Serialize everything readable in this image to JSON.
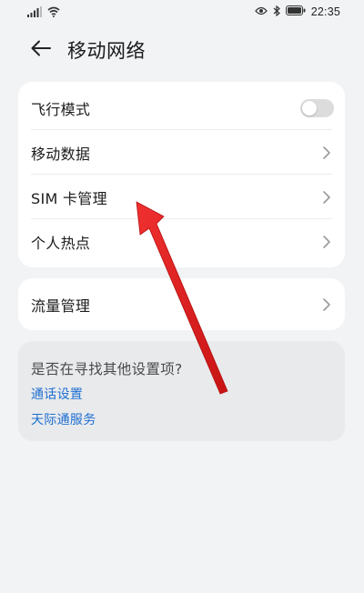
{
  "status_bar": {
    "time": "22:35",
    "icons": [
      "signal-icon",
      "wifi-icon",
      "eye-icon",
      "bluetooth-icon",
      "battery-icon"
    ]
  },
  "header": {
    "title": "移动网络",
    "back_icon": "back-arrow-icon"
  },
  "main_group": {
    "items": [
      {
        "label": "飞行模式",
        "control": "toggle",
        "toggle_on": false
      },
      {
        "label": "移动数据",
        "control": "chevron"
      },
      {
        "label": "SIM 卡管理",
        "control": "chevron"
      },
      {
        "label": "个人热点",
        "control": "chevron"
      }
    ]
  },
  "traffic_group": {
    "items": [
      {
        "label": "流量管理",
        "control": "chevron"
      }
    ]
  },
  "suggestions": {
    "title": "是否在寻找其他设置项?",
    "links": [
      "通话设置",
      "天际通服务"
    ]
  },
  "colors": {
    "background": "#f1f3f5",
    "card": "#ffffff",
    "link": "#1f6fd1",
    "annotation_arrow": "#e01e1e",
    "toggle_off": "#dcdcdc"
  }
}
